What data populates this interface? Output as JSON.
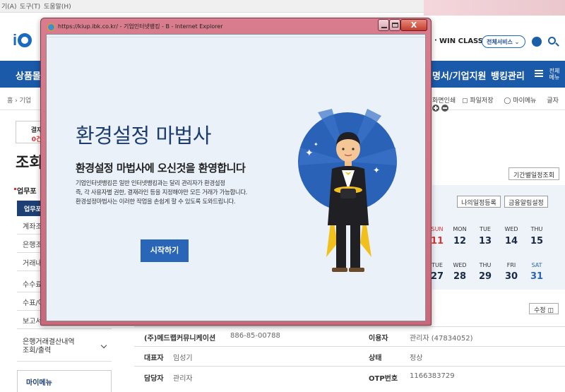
{
  "browser_menu": [
    "기(A)",
    "도구(T)",
    "도움말(H)"
  ],
  "site": {
    "logo": "i",
    "win_class": "WIN CLASS",
    "all_service": "전체서비스",
    "nav": [
      "상품몰",
      "명서/기업지원",
      "뱅킹관리"
    ],
    "nav_all": "전체\n메뉴",
    "breadcrumb": "홈 › 기업",
    "util": [
      "화면인쇄",
      "파일저장",
      "마이메뉴",
      "글자"
    ],
    "approval_label": "결재",
    "approval_count": "0건",
    "side_title": "조회",
    "side_sub": "업무포",
    "side_active": "업무포",
    "side_items": [
      "계좌조",
      "은행조",
      "거래내",
      "수수료",
      "수표/어",
      "보고서"
    ],
    "side_multi": "은행거래결산내역\n조회/출력",
    "my_menu": "마이메뉴",
    "period_button": "기간별일정조회",
    "cal_buttons": [
      "나의일정등록",
      "금융알림설정"
    ],
    "cal_week1_days": [
      "SUN",
      "MON",
      "TUE",
      "WED",
      "THU"
    ],
    "cal_week1_dates": [
      "11",
      "12",
      "13",
      "14",
      "15"
    ],
    "cal_week2_days": [
      "TUE",
      "WED",
      "THU",
      "FRI",
      "SAT"
    ],
    "cal_week2_dates": [
      "27",
      "28",
      "29",
      "30",
      "31"
    ],
    "edit_button": "수정",
    "info": {
      "company_label": "(주)메드랩커뮤니케이션",
      "company_value": "886-85-00788",
      "user_label": "이용자",
      "user_value": "관리자 (47834052)",
      "rep_label": "대표자",
      "rep_value": "임성기",
      "status_label": "상태",
      "status_value": "정상",
      "manager_label": "담당자",
      "manager_value": "관리자",
      "otp_label": "OTP번호",
      "otp_value": "1166383729"
    }
  },
  "popup": {
    "title": "https://kiup.ibk.co.kr/ - 기업인터넷뱅킹 - B - Internet Explorer",
    "heading": "환경설정 마법사",
    "welcome": "환경설정 마법사에 오신것을 환영합니다",
    "desc1": "기업인터넷뱅킹은 일반 인터넷뱅킹과는 달리 관리자가 환경설정",
    "desc2": "즉, 각 사용자별 권한, 결재라인 등을 지정해야만 모든 거래가 가능합니다.",
    "desc3": "환경설정마법사는 이러한 작업을 손쉽게 할 수 있도록 도와드립니다.",
    "start_button": "시작하기",
    "close_symbol": "X"
  },
  "colors": {
    "brand_blue": "#1a5aa8",
    "popup_frame": "#c9687b",
    "button_blue": "#2a66b8",
    "heading_navy": "#1d3d6e"
  }
}
